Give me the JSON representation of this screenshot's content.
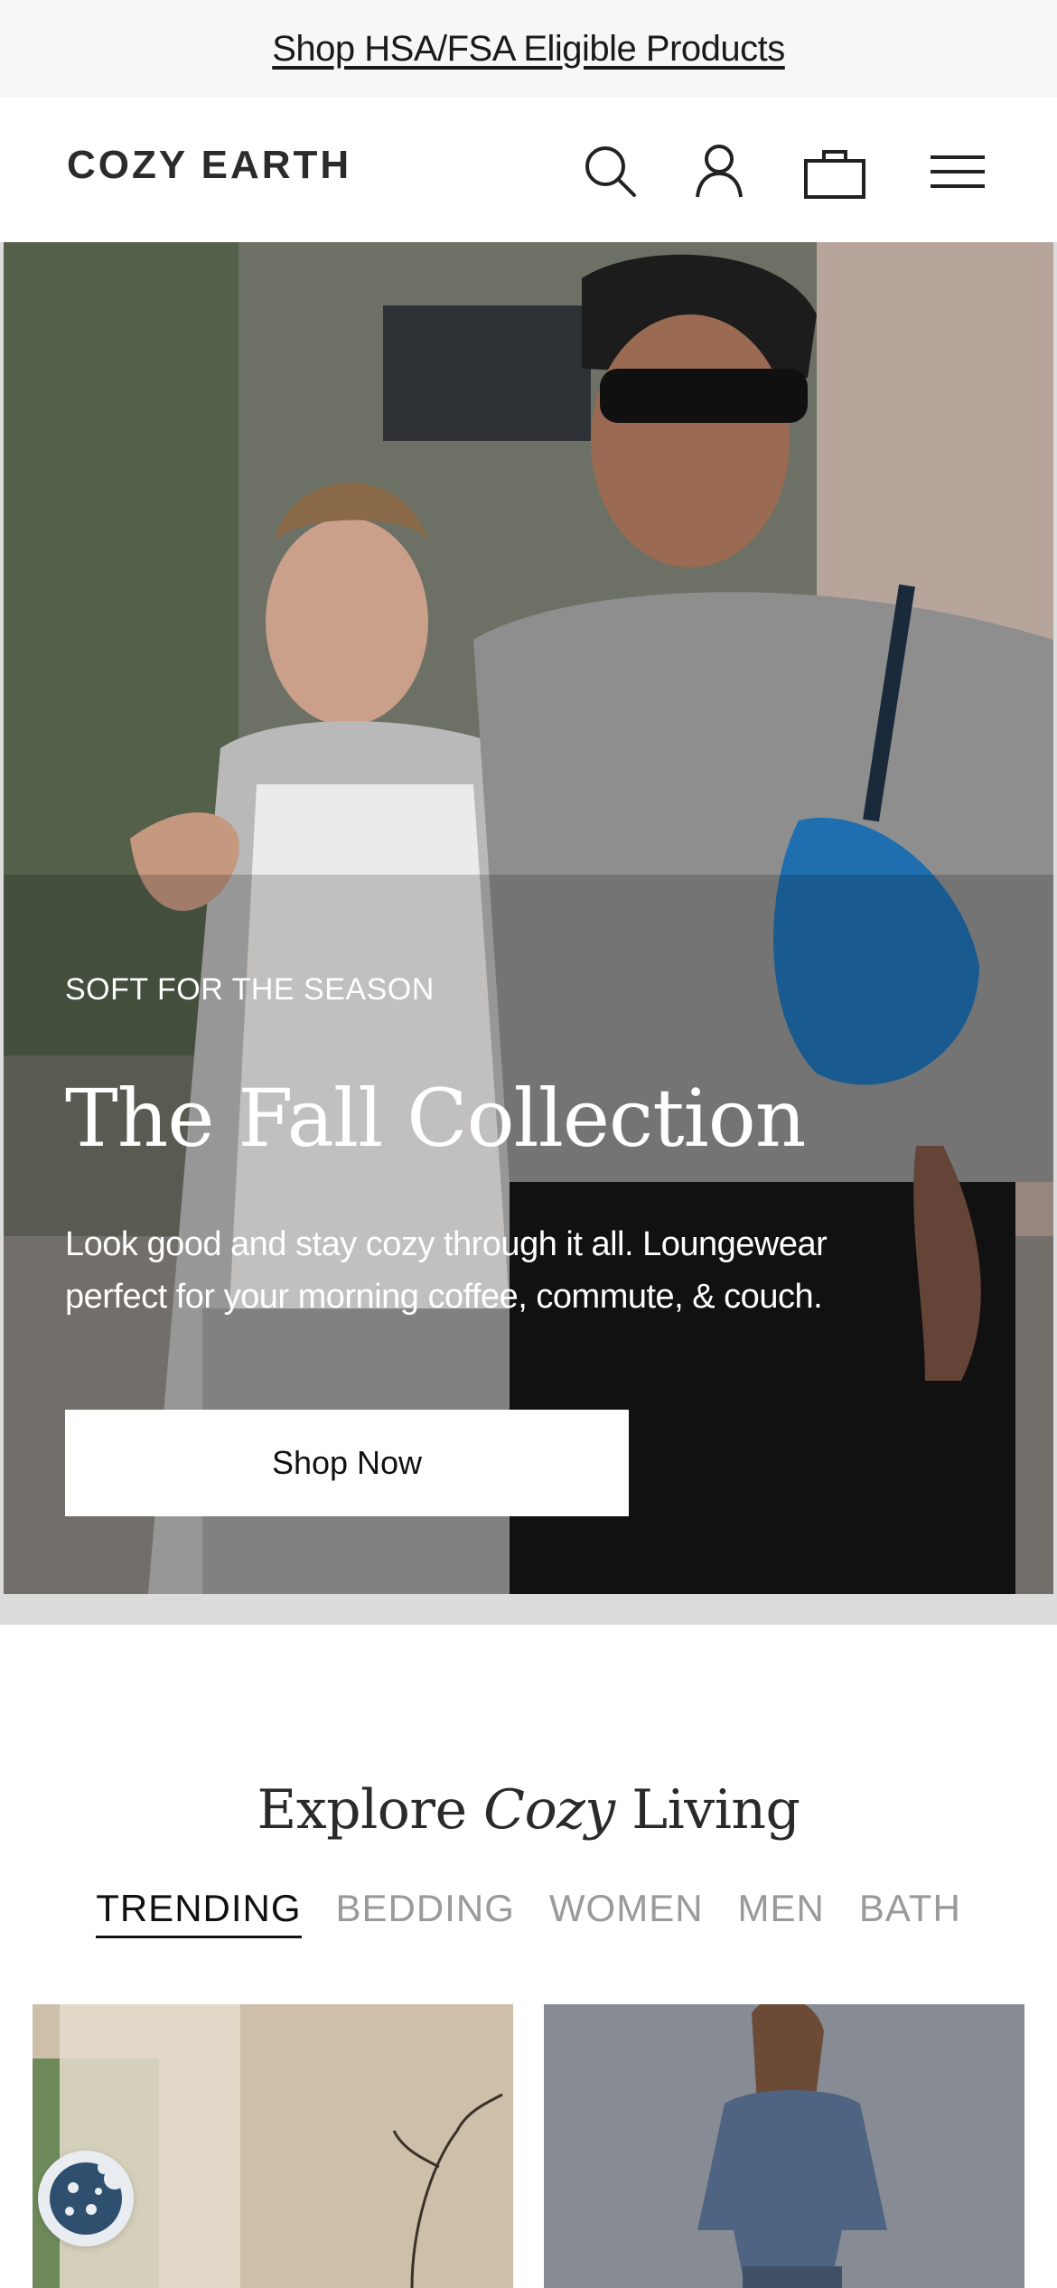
{
  "promo": {
    "label": "Shop HSA/FSA Eligible Products"
  },
  "header": {
    "logo": "COZY EARTH",
    "icons": [
      "search-icon",
      "account-icon",
      "shopping-bag-icon",
      "menu-icon"
    ]
  },
  "hero": {
    "eyebrow": "SOFT FOR THE SEASON",
    "title": "The Fall Collection",
    "body": "Look good and stay cozy through it all. Loungewear perfect for your morning coffee, commute, & couch.",
    "cta_label": "Shop Now"
  },
  "explore": {
    "title_start": "Explore ",
    "title_emphasis": "Cozy",
    "title_end": " Living",
    "tabs": [
      {
        "label": "TRENDING",
        "active": true
      },
      {
        "label": "BEDDING",
        "active": false
      },
      {
        "label": "WOMEN",
        "active": false
      },
      {
        "label": "MEN",
        "active": false
      },
      {
        "label": "BATH",
        "active": false
      }
    ]
  },
  "cookie_button": {
    "icon": "cookie-icon"
  },
  "colors": {
    "text": "#1a1a1a",
    "muted_tab": "#9a9a9a",
    "promo_bg": "#f7f7f7",
    "cookie_icon": "#2f4f6f"
  }
}
